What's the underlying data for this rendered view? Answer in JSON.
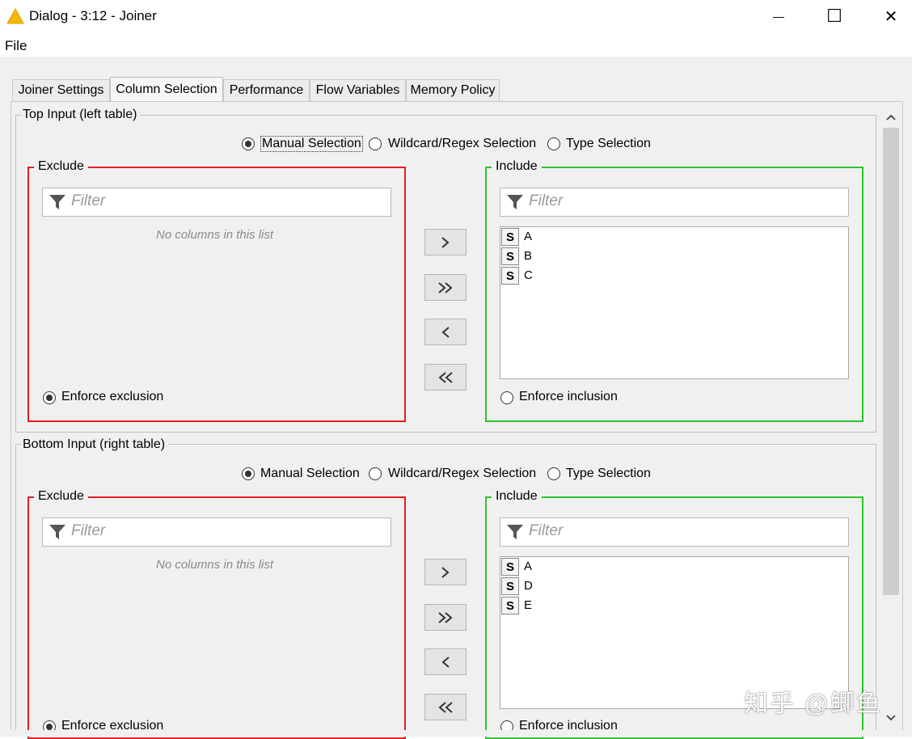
{
  "window": {
    "title": "Dialog - 3:12 - Joiner",
    "minimize_glyph": "—",
    "maximize_glyph": "☐",
    "close_glyph": "✕"
  },
  "menu": {
    "file": "File"
  },
  "tabs": [
    {
      "label": "Joiner Settings",
      "active": false
    },
    {
      "label": "Column Selection",
      "active": true
    },
    {
      "label": "Performance",
      "active": false
    },
    {
      "label": "Flow Variables",
      "active": false
    },
    {
      "label": "Memory Policy",
      "active": false
    }
  ],
  "top_input": {
    "title": "Top Input (left table)",
    "modes": [
      "Manual Selection",
      "Wildcard/Regex Selection",
      "Type Selection"
    ],
    "selected_mode": "Manual Selection",
    "exclude": {
      "title": "Exclude",
      "filter_placeholder": "Filter",
      "empty_message": "No columns in this list",
      "enforce_label": "Enforce exclusion",
      "enforce_checked": true
    },
    "include": {
      "title": "Include",
      "filter_placeholder": "Filter",
      "columns": [
        {
          "type": "S",
          "name": "A"
        },
        {
          "type": "S",
          "name": "B"
        },
        {
          "type": "S",
          "name": "C"
        }
      ],
      "enforce_label": "Enforce inclusion",
      "enforce_checked": false
    }
  },
  "bottom_input": {
    "title": "Bottom Input (right table)",
    "modes": [
      "Manual Selection",
      "Wildcard/Regex Selection",
      "Type Selection"
    ],
    "selected_mode": "Manual Selection",
    "exclude": {
      "title": "Exclude",
      "filter_placeholder": "Filter",
      "empty_message": "No columns in this list",
      "enforce_label": "Enforce exclusion",
      "enforce_checked": true
    },
    "include": {
      "title": "Include",
      "filter_placeholder": "Filter",
      "columns": [
        {
          "type": "S",
          "name": "A"
        },
        {
          "type": "S",
          "name": "D"
        },
        {
          "type": "S",
          "name": "E"
        }
      ],
      "enforce_label": "Enforce inclusion",
      "enforce_checked": false
    }
  },
  "move_buttons": [
    ">",
    "»",
    "<",
    "«"
  ],
  "watermark": "知乎 @鲫鱼",
  "colors": {
    "exclude_border": "#e02020",
    "include_border": "#2cc52c",
    "app_icon": "#f5b800"
  }
}
